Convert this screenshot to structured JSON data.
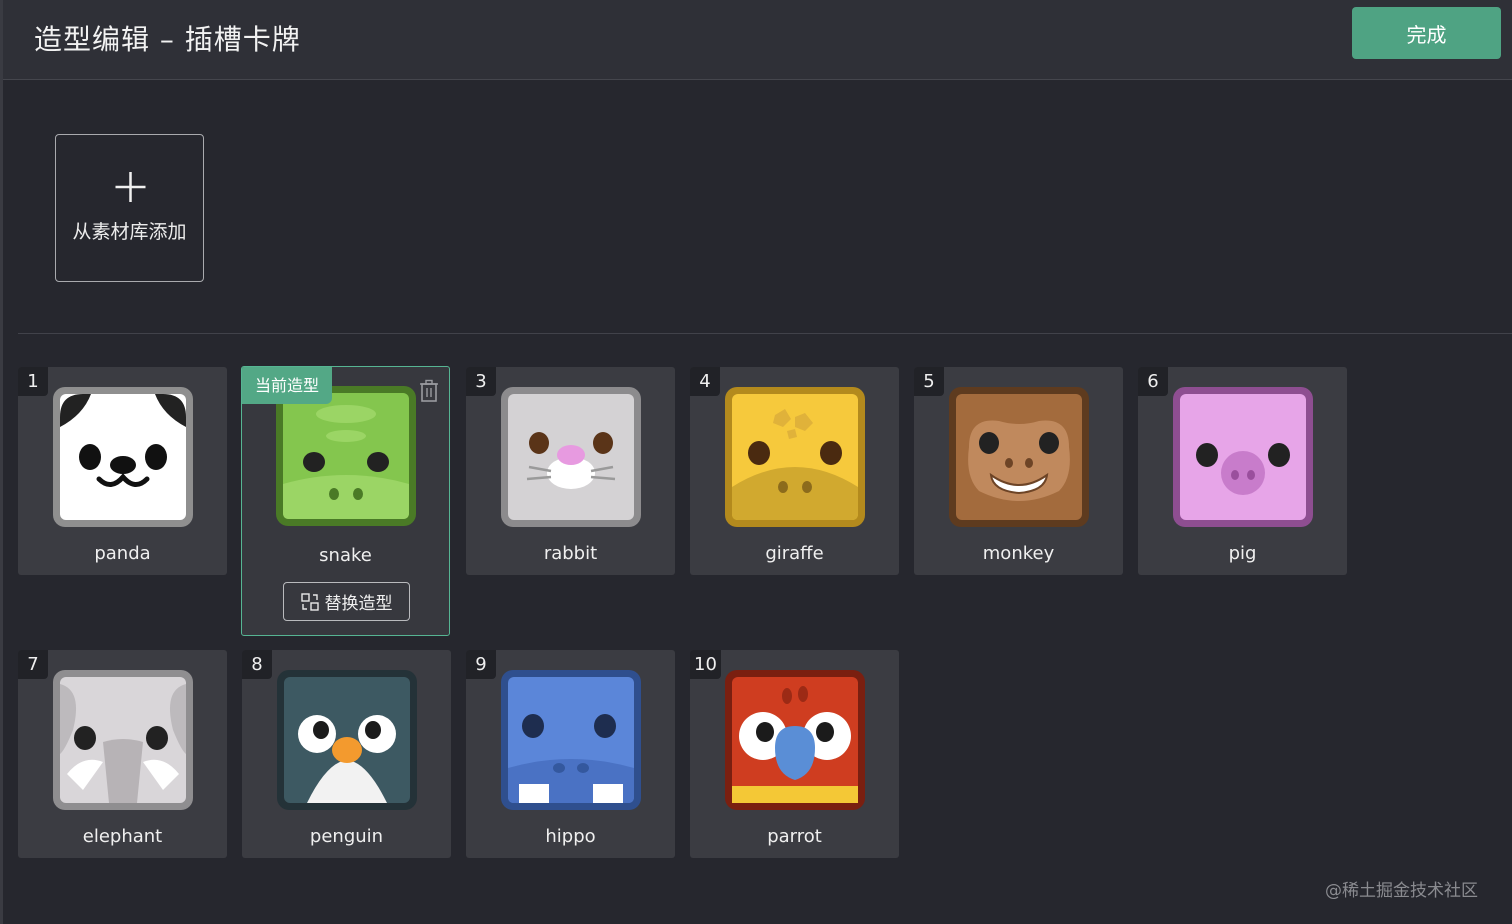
{
  "header": {
    "title": "造型编辑 – 插槽卡牌",
    "done_label": "完成"
  },
  "add_asset": {
    "label": "从素材库添加"
  },
  "current_tag": "当前造型",
  "replace_label": "替换造型",
  "costumes": [
    {
      "index": "1",
      "name": "panda",
      "bg_color": "#ffffff",
      "frame_color": "#8f8f8f"
    },
    {
      "index": "2",
      "name": "snake",
      "bg_color": "#84c64e",
      "frame_color": "#4a7a26",
      "selected": true
    },
    {
      "index": "3",
      "name": "rabbit",
      "bg_color": "#d4d2d4",
      "frame_color": "#8c8b8d"
    },
    {
      "index": "4",
      "name": "giraffe",
      "bg_color": "#f6c93c",
      "frame_color": "#b38a1d"
    },
    {
      "index": "5",
      "name": "monkey",
      "bg_color": "#a36b3d",
      "frame_color": "#5e3b1f"
    },
    {
      "index": "6",
      "name": "pig",
      "bg_color": "#e7a5e8",
      "frame_color": "#8e4e91"
    },
    {
      "index": "7",
      "name": "elephant",
      "bg_color": "#d9d6d9",
      "frame_color": "#8f8e90"
    },
    {
      "index": "8",
      "name": "penguin",
      "bg_color": "#3d5962",
      "frame_color": "#243238"
    },
    {
      "index": "9",
      "name": "hippo",
      "bg_color": "#5b86d9",
      "frame_color": "#2f4f8e"
    },
    {
      "index": "10",
      "name": "parrot",
      "bg_color": "#cf3d20",
      "frame_color": "#7a1f10"
    }
  ],
  "colors": {
    "accent": "#4fa383",
    "background": "#26272e",
    "card": "#3b3c42"
  },
  "watermark": "@稀土掘金技术社区"
}
